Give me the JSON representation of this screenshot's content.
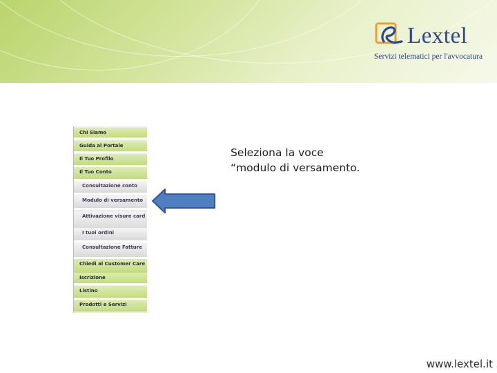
{
  "brand": {
    "name": "Lextel",
    "tagline": "Servizi telematici per l'avvocatura",
    "colors": {
      "blue": "#2b4596",
      "orange": "#e8a13a",
      "green": "#a8c85a"
    }
  },
  "menu": {
    "items": [
      {
        "label": "Chi Siamo",
        "kind": "main"
      },
      {
        "label": "Guida al Portale",
        "kind": "main"
      },
      {
        "label": "Il Tuo Profilo",
        "kind": "main"
      },
      {
        "label": "Il Tuo Conto",
        "kind": "main"
      },
      {
        "label": "Consultazione conto",
        "kind": "sub"
      },
      {
        "label": "Modulo di versamento",
        "kind": "sub"
      },
      {
        "label": "Attivazione visure card",
        "kind": "sub"
      },
      {
        "label": "I tuoi ordini",
        "kind": "sub"
      },
      {
        "label": "Consultazione Fatture",
        "kind": "sub"
      },
      {
        "label": "Chiedi al Customer Care",
        "kind": "main"
      },
      {
        "label": "Iscrizione",
        "kind": "main"
      },
      {
        "label": "Listino",
        "kind": "main"
      },
      {
        "label": "Prodotti e Servizi",
        "kind": "main"
      }
    ]
  },
  "instruction": {
    "line1": "Seleziona la voce",
    "line2": "“modulo di versamento."
  },
  "arrow": {
    "color": "#4f7fc0",
    "stroke": "#2f5597",
    "direction": "left"
  },
  "footer": {
    "url": "www.lextel.it"
  }
}
